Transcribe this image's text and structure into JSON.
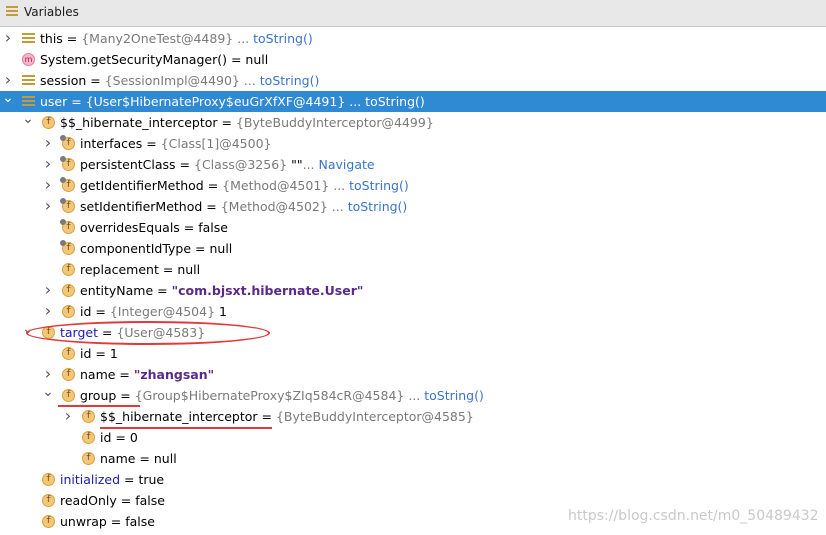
{
  "panel": {
    "title": "Variables"
  },
  "rows": [
    {
      "name": "this",
      "eq": " = ",
      "val": "{Many2OneTest@4489}",
      "ext": " ... ",
      "link": "toString()",
      "icon": "entry",
      "arrow": "right"
    },
    {
      "name": "System.getSecurityManager()",
      "eq": " = ",
      "val": "null",
      "icon": "method",
      "arrow": ""
    },
    {
      "name": "session",
      "eq": " = ",
      "val": "{SessionImpl@4490}",
      "ext": " ... ",
      "link": "toString()",
      "icon": "entry",
      "arrow": "right"
    },
    {
      "name": "user",
      "eq": " = ",
      "val": "{User$HibernateProxy$euGrXfXF@4491}",
      "ext": " ... ",
      "link": "toString()",
      "icon": "entry",
      "arrow": "down",
      "selected": true
    },
    {
      "name": "$$_hibernate_interceptor",
      "eq": " = ",
      "val": "{ByteBuddyInterceptor@4499}",
      "icon": "field",
      "arrow": "down"
    },
    {
      "name": "interfaces",
      "eq": " = ",
      "val": "{Class[1]@4500}",
      "icon": "field-final",
      "arrow": "right"
    },
    {
      "name": "persistentClass",
      "eq": " = ",
      "val": "{Class@3256}",
      "strext": " \"\"",
      "ext": "... ",
      "link": "Navigate",
      "icon": "field-final",
      "arrow": "right"
    },
    {
      "name": "getIdentifierMethod",
      "eq": " = ",
      "val": "{Method@4501}",
      "ext": " ... ",
      "link": "toString()",
      "icon": "field-final",
      "arrow": "right"
    },
    {
      "name": "setIdentifierMethod",
      "eq": " = ",
      "val": "{Method@4502}",
      "ext": " ... ",
      "link": "toString()",
      "icon": "field-final",
      "arrow": "right"
    },
    {
      "name": "overridesEquals",
      "eq": " = ",
      "val": "false",
      "icon": "field-final",
      "arrow": ""
    },
    {
      "name": "componentIdType",
      "eq": " = ",
      "val": "null",
      "icon": "field-final",
      "arrow": ""
    },
    {
      "name": "replacement",
      "eq": " = ",
      "val": "null",
      "icon": "field",
      "arrow": ""
    },
    {
      "name": "entityName",
      "eq": " = ",
      "val": "\"com.bjsxt.hibernate.User\"",
      "icon": "field",
      "arrow": "right"
    },
    {
      "name": "id",
      "eq": " = ",
      "val": "{Integer@4504}",
      "ext": " 1",
      "icon": "field",
      "arrow": "right"
    },
    {
      "name": "target",
      "eq": " = ",
      "val": "{User@4583}",
      "icon": "field",
      "arrow": "down"
    },
    {
      "name": "id",
      "eq": " = ",
      "val": "1",
      "icon": "field",
      "arrow": ""
    },
    {
      "name": "name",
      "eq": " = ",
      "val": "\"zhangsan\"",
      "icon": "field",
      "arrow": "right"
    },
    {
      "name": "group",
      "eq": " = ",
      "val": "{Group$HibernateProxy$ZIq584cR@4584}",
      "ext": " ... ",
      "link": "toString()",
      "icon": "field",
      "arrow": "down"
    },
    {
      "name": "$$_hibernate_interceptor",
      "eq": " = ",
      "val": "{ByteBuddyInterceptor@4585}",
      "icon": "field",
      "arrow": "right"
    },
    {
      "name": "id",
      "eq": " = ",
      "val": "0",
      "icon": "field",
      "arrow": ""
    },
    {
      "name": "name",
      "eq": " = ",
      "val": "null",
      "icon": "field",
      "arrow": ""
    },
    {
      "name": "initialized",
      "eq": " = ",
      "val": "true",
      "icon": "field",
      "arrow": ""
    },
    {
      "name": "readOnly",
      "eq": " = ",
      "val": "false",
      "icon": "field",
      "arrow": ""
    },
    {
      "name": "unwrap",
      "eq": " = ",
      "val": "false",
      "icon": "field",
      "arrow": ""
    }
  ],
  "icon_glyph": "f",
  "method_glyph": "m",
  "watermark": "https://blog.csdn.net/m0_50489432",
  "colors": {
    "selection": "#2f8ad3",
    "annotation": "#e23a3a",
    "link": "#3a74c9",
    "string": "#5a2a8a"
  }
}
